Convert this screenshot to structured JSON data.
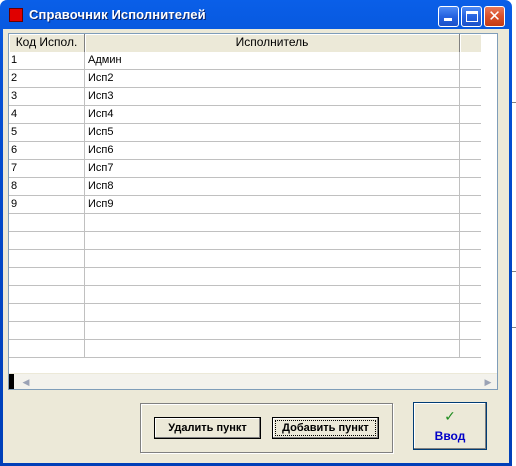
{
  "window": {
    "title": "Справочник Исполнителей",
    "buttons": [
      "minimize",
      "maximize",
      "close"
    ]
  },
  "grid": {
    "columns": [
      "Код Испол.",
      "Исполнитель"
    ],
    "rows": [
      {
        "code": "1",
        "name": "Админ"
      },
      {
        "code": "2",
        "name": "Исп2"
      },
      {
        "code": "3",
        "name": "Исп3"
      },
      {
        "code": "4",
        "name": "Исп4"
      },
      {
        "code": "5",
        "name": "Исп5"
      },
      {
        "code": "6",
        "name": "Исп6"
      },
      {
        "code": "7",
        "name": "Исп7"
      },
      {
        "code": "8",
        "name": "Исп8"
      },
      {
        "code": "9",
        "name": "Исп9"
      }
    ]
  },
  "actions": {
    "delete_label": "Удалить пункт",
    "add_label": "Добавить пункт",
    "enter_label": "Ввод"
  },
  "icons": {
    "window": "app-red-square-icon",
    "enter": "green-check-icon"
  }
}
